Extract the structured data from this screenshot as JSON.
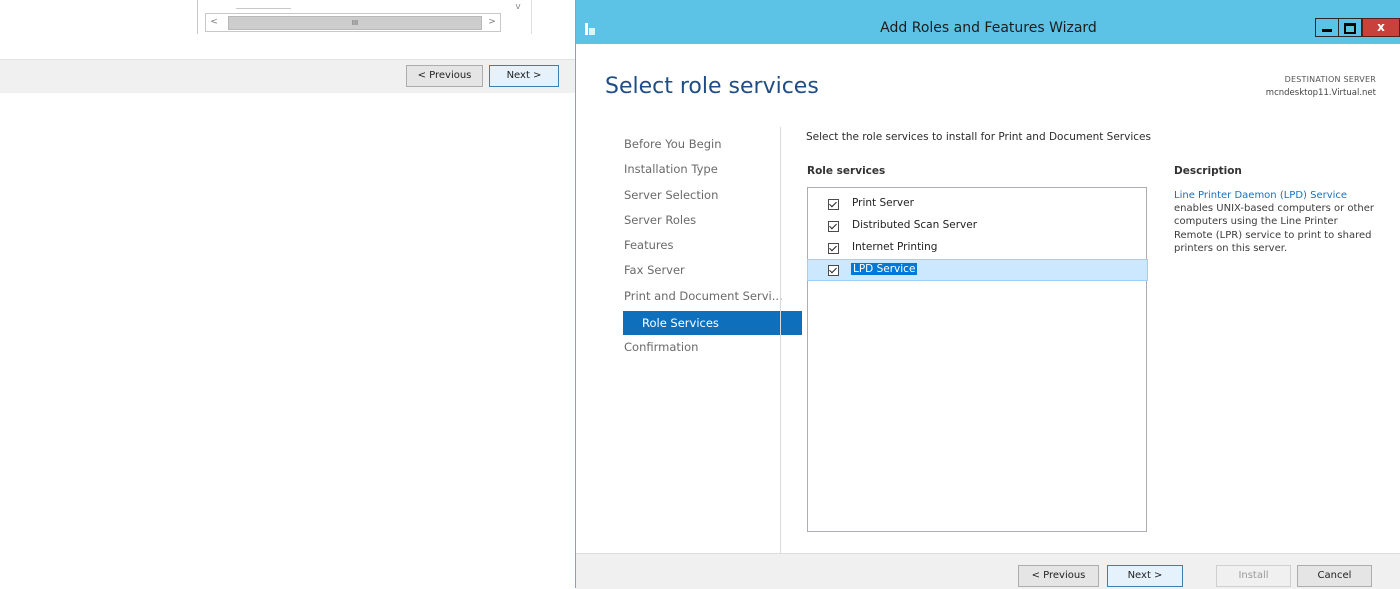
{
  "background_window": {
    "scroll_left_glyph": "<",
    "scroll_right_glyph": ">",
    "scroll_up_glyph": "v",
    "thumb_glyph": "III",
    "previous_label": "< Previous",
    "next_label": "Next >"
  },
  "window": {
    "title": "Add Roles and Features Wizard",
    "close_glyph": "x"
  },
  "header": {
    "page_title": "Select role services",
    "destination_label": "DESTINATION SERVER",
    "destination_server": "mcndesktop11.Virtual.net"
  },
  "nav": {
    "items": [
      {
        "label": "Before You Begin"
      },
      {
        "label": "Installation Type"
      },
      {
        "label": "Server Selection"
      },
      {
        "label": "Server Roles"
      },
      {
        "label": "Features"
      },
      {
        "label": "Fax Server"
      },
      {
        "label": "Print and Document Servi..."
      },
      {
        "label": "Role Services",
        "active": true
      },
      {
        "label": "Confirmation"
      }
    ]
  },
  "main": {
    "instruction": "Select the role services to install for Print and Document Services",
    "role_services_header": "Role services",
    "role_services": [
      {
        "label": "Print Server",
        "checked": true
      },
      {
        "label": "Distributed Scan Server",
        "checked": true
      },
      {
        "label": "Internet Printing",
        "checked": true
      },
      {
        "label": "LPD Service",
        "checked": true,
        "selected": true
      }
    ],
    "description_header": "Description",
    "description_link": "Line Printer Daemon (LPD) Service",
    "description_text": " enables UNIX-based computers or other computers using the Line Printer Remote (LPR) service to print to shared printers on this server."
  },
  "footer": {
    "previous_label": "< Previous",
    "next_label": "Next >",
    "install_label": "Install",
    "cancel_label": "Cancel"
  }
}
